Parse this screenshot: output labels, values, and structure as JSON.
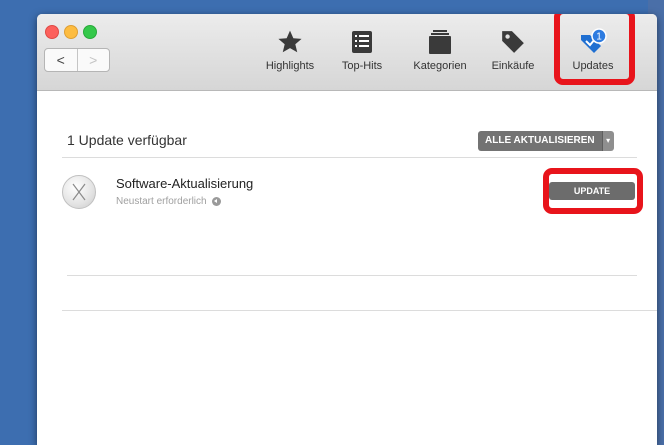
{
  "toolbar": {
    "back_label": "<",
    "forward_label": ">",
    "items": [
      {
        "label": "Highlights",
        "icon": "star-icon"
      },
      {
        "label": "Top-Hits",
        "icon": "list-icon"
      },
      {
        "label": "Kategorien",
        "icon": "categories-icon"
      },
      {
        "label": "Einkäufe",
        "icon": "tag-icon"
      },
      {
        "label": "Updates",
        "icon": "updates-icon",
        "badge": "1"
      }
    ]
  },
  "main": {
    "section_title": "1 Update verfügbar",
    "update_all_label": "ALLE AKTUALISIEREN",
    "update_all_dropdown": "▾",
    "updates": [
      {
        "name": "Software-Aktualisierung",
        "subtitle": "Neustart erforderlich",
        "button_label": "UPDATE",
        "icon": "osx-x-icon"
      }
    ]
  },
  "colors": {
    "highlight": "#e8141b",
    "accent_blue": "#1f6fd1",
    "button_gray": "#6c6c6c"
  }
}
